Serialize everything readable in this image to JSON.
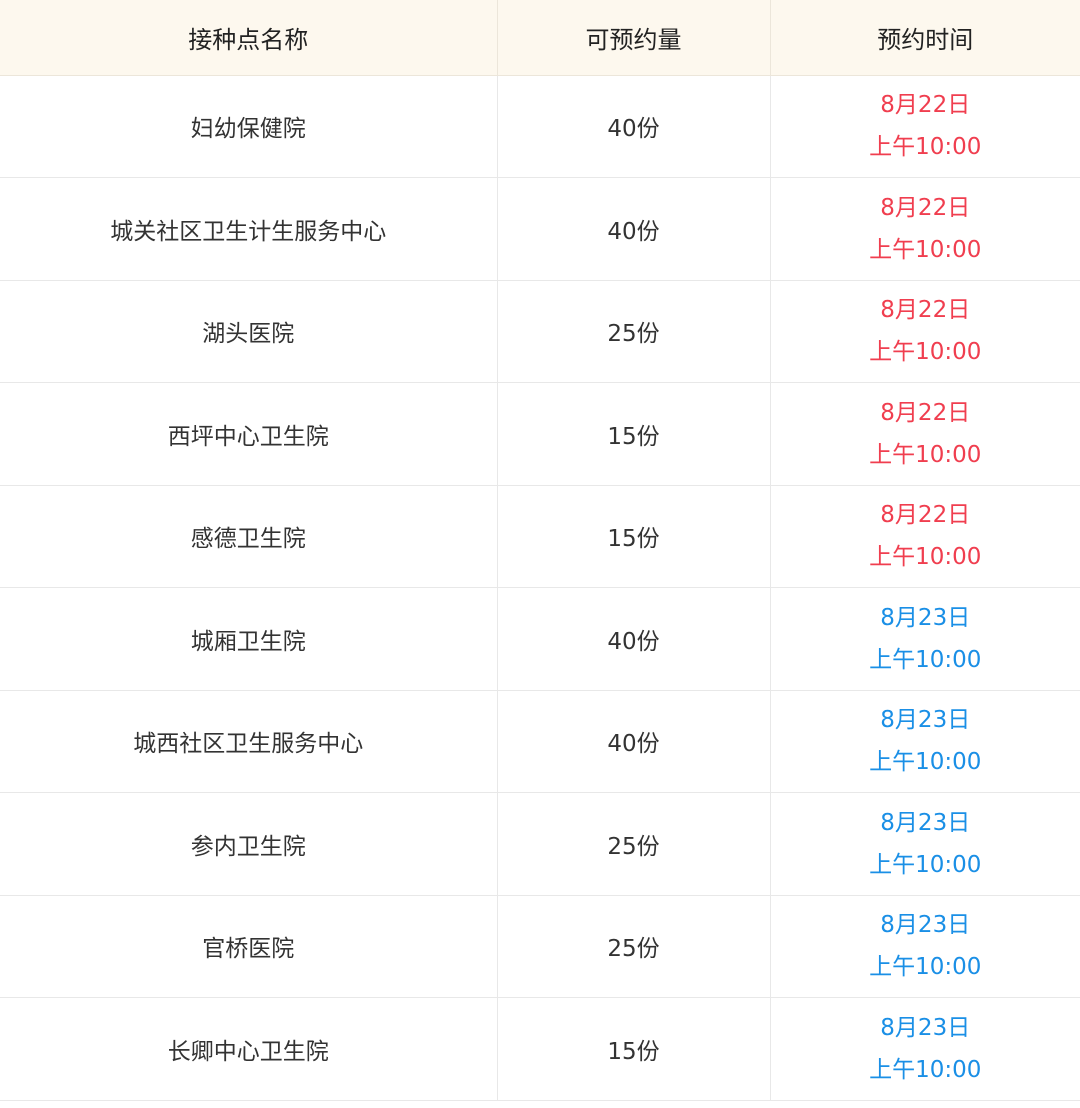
{
  "header": {
    "site_name": "接种点名称",
    "available": "可预约量",
    "time": "预约时间"
  },
  "colors": {
    "header_bg": "#fdf8ee",
    "date_22": "#f03e4f",
    "date_23": "#1a8fe6"
  },
  "rows": [
    {
      "site": "妇幼保健院",
      "qty": "40份",
      "date": "8月22日",
      "time": "上午10:00",
      "tone": "red"
    },
    {
      "site": "城关社区卫生计生服务中心",
      "qty": "40份",
      "date": "8月22日",
      "time": "上午10:00",
      "tone": "red"
    },
    {
      "site": "湖头医院",
      "qty": "25份",
      "date": "8月22日",
      "time": "上午10:00",
      "tone": "red"
    },
    {
      "site": "西坪中心卫生院",
      "qty": "15份",
      "date": "8月22日",
      "time": "上午10:00",
      "tone": "red"
    },
    {
      "site": "感德卫生院",
      "qty": "15份",
      "date": "8月22日",
      "time": "上午10:00",
      "tone": "red"
    },
    {
      "site": "城厢卫生院",
      "qty": "40份",
      "date": "8月23日",
      "time": "上午10:00",
      "tone": "blue"
    },
    {
      "site": "城西社区卫生服务中心",
      "qty": "40份",
      "date": "8月23日",
      "time": "上午10:00",
      "tone": "blue"
    },
    {
      "site": "参内卫生院",
      "qty": "25份",
      "date": "8月23日",
      "time": "上午10:00",
      "tone": "blue"
    },
    {
      "site": "官桥医院",
      "qty": "25份",
      "date": "8月23日",
      "time": "上午10:00",
      "tone": "blue"
    },
    {
      "site": "长卿中心卫生院",
      "qty": "15份",
      "date": "8月23日",
      "time": "上午10:00",
      "tone": "blue"
    }
  ]
}
